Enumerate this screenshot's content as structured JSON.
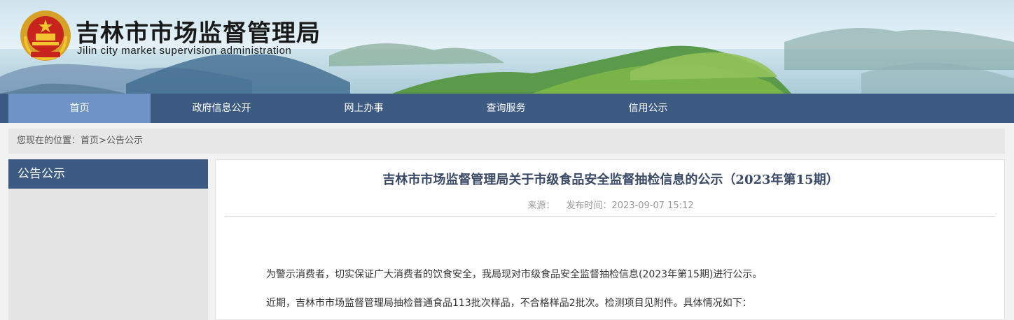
{
  "header": {
    "title": "吉林市市场监督管理局",
    "subtitle": "Jilin city market supervision administration"
  },
  "nav": {
    "items": [
      {
        "label": "首页",
        "active": true
      },
      {
        "label": "政府信息公开",
        "active": false
      },
      {
        "label": "网上办事",
        "active": false
      },
      {
        "label": "查询服务",
        "active": false
      },
      {
        "label": "信用公示",
        "active": false
      }
    ]
  },
  "breadcrumb": {
    "prefix": "您现在的位置：",
    "home": "首页",
    "separator": ">",
    "current": "公告公示"
  },
  "sidebar": {
    "heading": "公告公示"
  },
  "article": {
    "title": "吉林市市场监督管理局关于市级食品安全监督抽检信息的公示（2023年第15期）",
    "source_label": "来源：",
    "published_label": "发布时间：",
    "published_time": "2023-09-07 15:12",
    "paragraphs": [
      "为警示消费者，切实保证广大消费者的饮食安全，我局现对市级食品安全监督抽检信息(2023年第15期)进行公示。",
      "近期，吉林市市场监督管理局抽检普通食品113批次样品，不合格样品2批次。检测项目见附件。具体情况如下："
    ]
  },
  "colors": {
    "nav_bg": "#3c5a82",
    "nav_active": "#6e93c5",
    "title_color": "#3a4a66"
  }
}
